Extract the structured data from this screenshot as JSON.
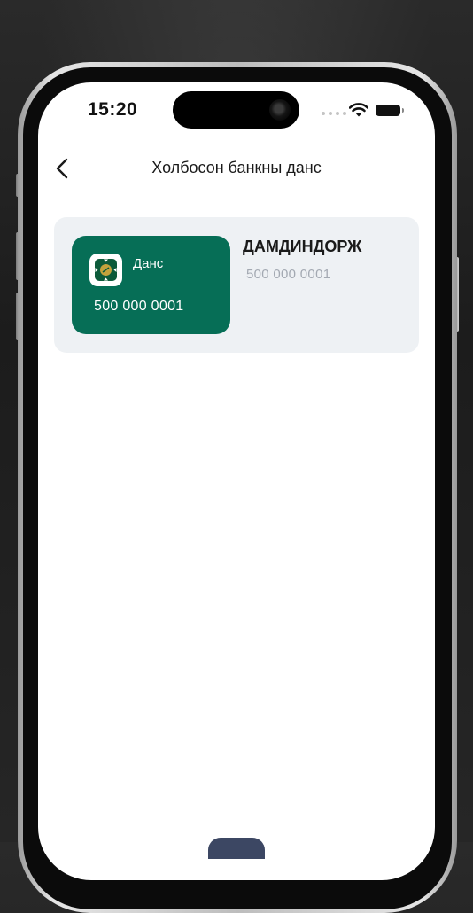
{
  "status_bar": {
    "time": "15:20"
  },
  "header": {
    "title": "Холбосон банкны данс",
    "back_icon": "chevron-left-icon"
  },
  "account": {
    "card_label": "Данс",
    "card_number": "500 000 0001",
    "holder_name": "ДАМДИНДОРЖ",
    "account_number": "500 000 0001",
    "card_color": "#066e56",
    "bank_logo_icon": "bank-logo-icon"
  },
  "colors": {
    "card_background": "#eef1f4",
    "muted_text": "#a3a9b2"
  }
}
